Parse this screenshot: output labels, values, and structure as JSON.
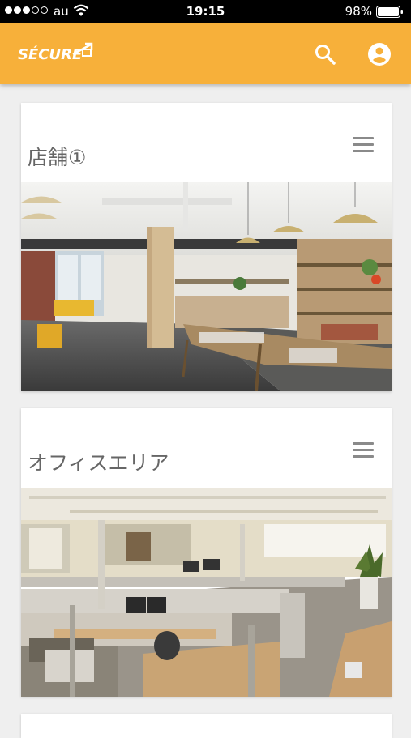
{
  "status_bar": {
    "carrier": "au",
    "time": "19:15",
    "battery": "98%"
  },
  "app_bar": {
    "logo_text": "SÉCURE",
    "icons": [
      "search-icon",
      "account-circle-icon"
    ],
    "color": "#f7b03a"
  },
  "cards": [
    {
      "title": "店舗①",
      "image_desc_icon": "store-photo"
    },
    {
      "title": "オフィスエリア",
      "image_desc_icon": "office-photo"
    }
  ]
}
